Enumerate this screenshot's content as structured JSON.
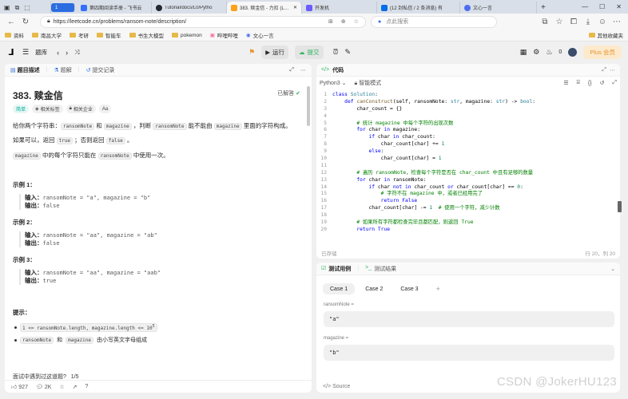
{
  "browser": {
    "tabs": [
      {
        "title": "第四期阅读手册 - 飞书云",
        "favicon_color": "#3370ff"
      },
      {
        "title": "Tutorial/docs/L0/Pytho",
        "favicon_color": "#24292f"
      },
      {
        "title": "383. 赎金信 - 力扣 (Leet",
        "favicon_color": "#ffa116",
        "active": true
      },
      {
        "title": "开发机",
        "favicon_color": "#6b5cff"
      },
      {
        "title": "(12 封私信 / 2 条消息) 有",
        "favicon_color": "#056de8"
      },
      {
        "title": "文心一言",
        "favicon_color": "#4e6ef2"
      }
    ],
    "url": "https://leetcode.cn/problems/ransom-note/description/",
    "search_placeholder": "点此搜索",
    "bookmarks": [
      "资料",
      "南昌大学",
      "考研",
      "智能车",
      "书生大模型",
      "pokemon",
      "哔哩哔哩",
      "文心一言"
    ],
    "other_bookmarks": "其他收藏夹"
  },
  "toolbar": {
    "problem_list": "题库",
    "run": "运行",
    "submit": "提交",
    "streak": "0",
    "plus": "Plus 会员"
  },
  "left": {
    "tabs": [
      "题目描述",
      "题解",
      "提交记录"
    ],
    "title": "383. 赎金信",
    "solved": "已解答",
    "tags": [
      "简单",
      "相关标签",
      "相关企业",
      "Aa"
    ],
    "intro_1": "给你两个字符串：",
    "intro_code_1": "ransomNote",
    "intro_and": "和",
    "intro_code_2": "magazine",
    "intro_2": "，判断",
    "intro_code_3": "ransomNote",
    "intro_3": "能不能由",
    "intro_code_4": "magazine",
    "intro_4": "里面的字符构成。",
    "line2_a": "如果可以，返回",
    "line2_true": "true",
    "line2_b": "；否则返回",
    "line2_false": "false",
    "line2_c": "。",
    "line3_code1": "magazine",
    "line3_a": "中的每个字符只能在",
    "line3_code2": "ransomNote",
    "line3_b": "中使用一次。",
    "examples": [
      {
        "title": "示例 1：",
        "input_label": "输入：",
        "input": "ransomNote = \"a\", magazine = \"b\"",
        "output_label": "输出：",
        "output": "false"
      },
      {
        "title": "示例 2：",
        "input_label": "输入：",
        "input": "ransomNote = \"aa\", magazine = \"ab\"",
        "output_label": "输出：",
        "output": "false"
      },
      {
        "title": "示例 3：",
        "input_label": "输入：",
        "input": "ransomNote = \"aa\", magazine = \"aab\"",
        "output_label": "输出：",
        "output": "true"
      }
    ],
    "hint_title": "提示：",
    "hint_1": "1 <= ransomNote.length, magazine.length <= 10",
    "hint_1_sup": "5",
    "hint_2_code1": "ransomNote",
    "hint_2_and": "和",
    "hint_2_code2": "magazine",
    "hint_2_text": "由小写英文字母组成",
    "interview": "面试中遇到过这道题?",
    "interview_count": "1/5",
    "likes": "927",
    "comments": "2K"
  },
  "editor": {
    "header": "代码",
    "language": "Python3",
    "mode": "智能模式",
    "saved": "已存储",
    "cursor": "行 20，列 20",
    "code_lines": [
      [
        [
          "kw",
          "class "
        ],
        [
          "ty",
          "Solution"
        ],
        [
          "ct",
          ":"
        ]
      ],
      [
        [
          "ct",
          "    "
        ],
        [
          "kw",
          "def "
        ],
        [
          "fn",
          "canConstruct"
        ],
        [
          "ct",
          "(self, ransomNote: "
        ],
        [
          "ty",
          "str"
        ],
        [
          "ct",
          ", magazine: "
        ],
        [
          "ty",
          "str"
        ],
        [
          "ct",
          ") -> "
        ],
        [
          "ty",
          "bool"
        ],
        [
          "ct",
          ":"
        ]
      ],
      [
        [
          "ct",
          "        char_count = {}"
        ]
      ],
      [
        [
          "ct",
          ""
        ]
      ],
      [
        [
          "ct",
          "        "
        ],
        [
          "cm",
          "# 统计 magazine 中每个字符的出现次数"
        ]
      ],
      [
        [
          "ct",
          "        "
        ],
        [
          "kw",
          "for "
        ],
        [
          "ct",
          "char "
        ],
        [
          "kw",
          "in "
        ],
        [
          "ct",
          "magazine:"
        ]
      ],
      [
        [
          "ct",
          "            "
        ],
        [
          "kw",
          "if "
        ],
        [
          "ct",
          "char "
        ],
        [
          "kw",
          "in "
        ],
        [
          "ct",
          "char_count:"
        ]
      ],
      [
        [
          "ct",
          "                char_count[char] += "
        ],
        [
          "num",
          "1"
        ]
      ],
      [
        [
          "ct",
          "            "
        ],
        [
          "kw",
          "else"
        ],
        [
          "ct",
          ":"
        ]
      ],
      [
        [
          "ct",
          "                char_count[char] = "
        ],
        [
          "num",
          "1"
        ]
      ],
      [
        [
          "ct",
          ""
        ]
      ],
      [
        [
          "ct",
          "        "
        ],
        [
          "cm",
          "# 遍历 ransomNote，检查每个字符是否在 char_count 中且有足够的数量"
        ]
      ],
      [
        [
          "ct",
          "        "
        ],
        [
          "kw",
          "for "
        ],
        [
          "ct",
          "char "
        ],
        [
          "kw",
          "in "
        ],
        [
          "ct",
          "ransomNote:"
        ]
      ],
      [
        [
          "ct",
          "            "
        ],
        [
          "kw",
          "if "
        ],
        [
          "ct",
          "char "
        ],
        [
          "kw",
          "not in "
        ],
        [
          "ct",
          "char_count "
        ],
        [
          "kw",
          "or "
        ],
        [
          "ct",
          "char_count[char] == "
        ],
        [
          "num",
          "0"
        ],
        [
          "ct",
          ":"
        ]
      ],
      [
        [
          "ct",
          "                "
        ],
        [
          "cm",
          "# 字符不在 magazine 中，或者已经用完了"
        ]
      ],
      [
        [
          "ct",
          "                "
        ],
        [
          "kw",
          "return "
        ],
        [
          "kw",
          "False"
        ]
      ],
      [
        [
          "ct",
          "            char_count[char] -= "
        ],
        [
          "num",
          "1"
        ],
        [
          "ct",
          "  "
        ],
        [
          "cm",
          "# 使用一个字符，减少计数"
        ]
      ],
      [
        [
          "ct",
          ""
        ]
      ],
      [
        [
          "ct",
          "        "
        ],
        [
          "cm",
          "# 如果所有字符都检查完毕且都匹配，则返回 True"
        ]
      ],
      [
        [
          "ct",
          "        "
        ],
        [
          "kw",
          "return "
        ],
        [
          "kw",
          "True"
        ]
      ]
    ]
  },
  "testcase": {
    "tab": "测试用例",
    "result_tab": "测试结果",
    "cases": [
      "Case 1",
      "Case 2",
      "Case 3"
    ],
    "add": "+",
    "field1_label": "ransomNote =",
    "field1_value": "\"a\"",
    "field2_label": "magazine =",
    "field2_value": "\"b\"",
    "source": "Source",
    "watermark": "CSDN @JokerHU123"
  }
}
